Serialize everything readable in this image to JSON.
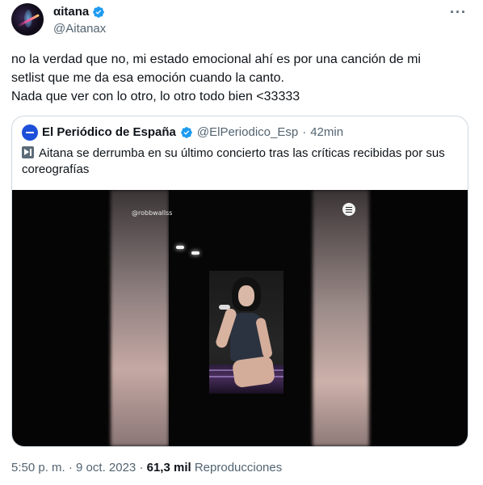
{
  "author": {
    "display_name": "αitana",
    "handle": "@Aitanax",
    "verified": true,
    "verified_color": "#1d9bf0"
  },
  "tweet": {
    "lines": [
      "no la verdad que no, mi estado emocional ahí es por una canción de mi",
      "setlist que me da esa emoción cuando la canto.",
      "Nada que ver con lo otro, lo otro todo bien <33333"
    ]
  },
  "quote": {
    "source_name": "El Periódico de España",
    "source_handle": "@ElPeriodico_Esp",
    "separator": "·",
    "time_ago": "42min",
    "text": "Aitana se derrumba en su último concierto tras las críticas recibidas por sus coreografías",
    "video_watermark": "@robbwallss",
    "source_logo_color": "#1d4fd8"
  },
  "meta": {
    "time": "5:50 p. m.",
    "dot": "·",
    "date": "9 oct. 2023",
    "views_count": "61,3 mil",
    "views_label": "Reproducciones"
  },
  "icons": {
    "more": "more-options-icon",
    "verified": "verified-badge-icon",
    "video": "video-play-icon"
  }
}
